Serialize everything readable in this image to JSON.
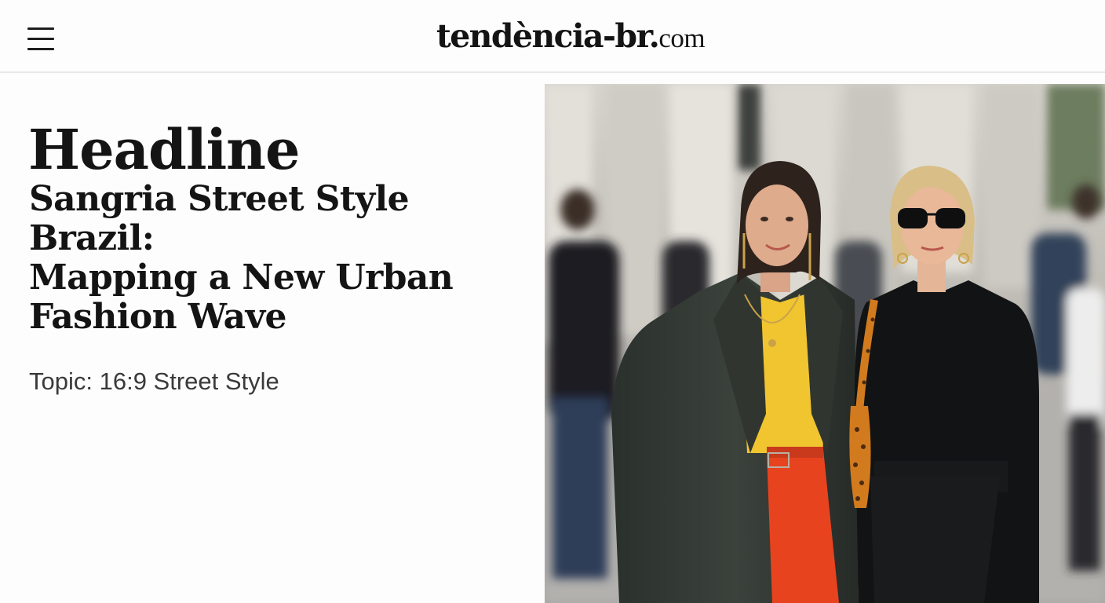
{
  "header": {
    "menu_icon": "hamburger-menu-icon",
    "logo_main": "tendència-br.",
    "logo_tld": "com"
  },
  "article": {
    "label": "Headline",
    "title_lines": [
      "Sangria Street Style",
      "Brazil:",
      "Mapping a New Urban",
      "Fashion Wave"
    ],
    "topic": "Topic: 16:9 Street Style"
  },
  "colors": {
    "text": "#141414",
    "topic_text": "#3a3a3a",
    "background": "#fdfdfd",
    "divider": "#e7e7e7"
  }
}
